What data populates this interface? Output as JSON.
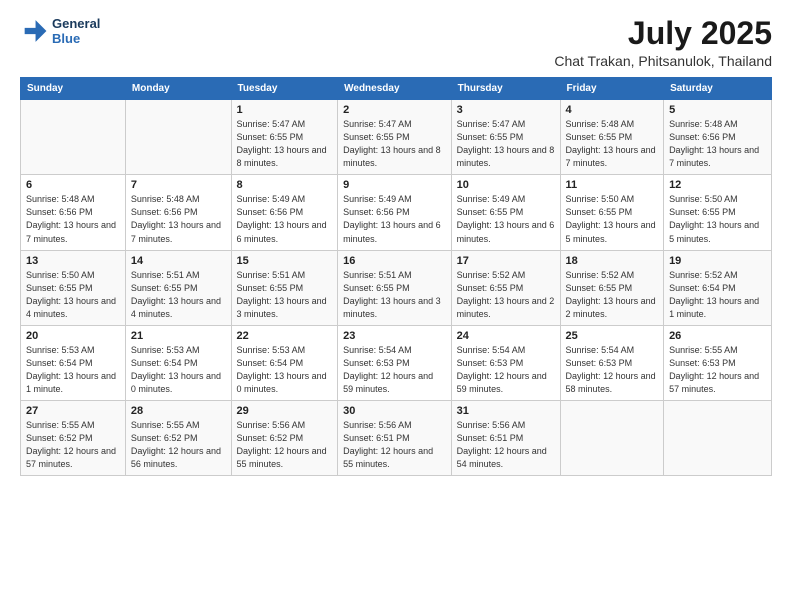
{
  "header": {
    "logo_line1": "General",
    "logo_line2": "Blue",
    "title": "July 2025",
    "subtitle": "Chat Trakan, Phitsanulok, Thailand"
  },
  "days_of_week": [
    "Sunday",
    "Monday",
    "Tuesday",
    "Wednesday",
    "Thursday",
    "Friday",
    "Saturday"
  ],
  "weeks": [
    [
      {
        "day": "",
        "info": ""
      },
      {
        "day": "",
        "info": ""
      },
      {
        "day": "1",
        "info": "Sunrise: 5:47 AM\nSunset: 6:55 PM\nDaylight: 13 hours and 8 minutes."
      },
      {
        "day": "2",
        "info": "Sunrise: 5:47 AM\nSunset: 6:55 PM\nDaylight: 13 hours and 8 minutes."
      },
      {
        "day": "3",
        "info": "Sunrise: 5:47 AM\nSunset: 6:55 PM\nDaylight: 13 hours and 8 minutes."
      },
      {
        "day": "4",
        "info": "Sunrise: 5:48 AM\nSunset: 6:55 PM\nDaylight: 13 hours and 7 minutes."
      },
      {
        "day": "5",
        "info": "Sunrise: 5:48 AM\nSunset: 6:56 PM\nDaylight: 13 hours and 7 minutes."
      }
    ],
    [
      {
        "day": "6",
        "info": "Sunrise: 5:48 AM\nSunset: 6:56 PM\nDaylight: 13 hours and 7 minutes."
      },
      {
        "day": "7",
        "info": "Sunrise: 5:48 AM\nSunset: 6:56 PM\nDaylight: 13 hours and 7 minutes."
      },
      {
        "day": "8",
        "info": "Sunrise: 5:49 AM\nSunset: 6:56 PM\nDaylight: 13 hours and 6 minutes."
      },
      {
        "day": "9",
        "info": "Sunrise: 5:49 AM\nSunset: 6:56 PM\nDaylight: 13 hours and 6 minutes."
      },
      {
        "day": "10",
        "info": "Sunrise: 5:49 AM\nSunset: 6:55 PM\nDaylight: 13 hours and 6 minutes."
      },
      {
        "day": "11",
        "info": "Sunrise: 5:50 AM\nSunset: 6:55 PM\nDaylight: 13 hours and 5 minutes."
      },
      {
        "day": "12",
        "info": "Sunrise: 5:50 AM\nSunset: 6:55 PM\nDaylight: 13 hours and 5 minutes."
      }
    ],
    [
      {
        "day": "13",
        "info": "Sunrise: 5:50 AM\nSunset: 6:55 PM\nDaylight: 13 hours and 4 minutes."
      },
      {
        "day": "14",
        "info": "Sunrise: 5:51 AM\nSunset: 6:55 PM\nDaylight: 13 hours and 4 minutes."
      },
      {
        "day": "15",
        "info": "Sunrise: 5:51 AM\nSunset: 6:55 PM\nDaylight: 13 hours and 3 minutes."
      },
      {
        "day": "16",
        "info": "Sunrise: 5:51 AM\nSunset: 6:55 PM\nDaylight: 13 hours and 3 minutes."
      },
      {
        "day": "17",
        "info": "Sunrise: 5:52 AM\nSunset: 6:55 PM\nDaylight: 13 hours and 2 minutes."
      },
      {
        "day": "18",
        "info": "Sunrise: 5:52 AM\nSunset: 6:55 PM\nDaylight: 13 hours and 2 minutes."
      },
      {
        "day": "19",
        "info": "Sunrise: 5:52 AM\nSunset: 6:54 PM\nDaylight: 13 hours and 1 minute."
      }
    ],
    [
      {
        "day": "20",
        "info": "Sunrise: 5:53 AM\nSunset: 6:54 PM\nDaylight: 13 hours and 1 minute."
      },
      {
        "day": "21",
        "info": "Sunrise: 5:53 AM\nSunset: 6:54 PM\nDaylight: 13 hours and 0 minutes."
      },
      {
        "day": "22",
        "info": "Sunrise: 5:53 AM\nSunset: 6:54 PM\nDaylight: 13 hours and 0 minutes."
      },
      {
        "day": "23",
        "info": "Sunrise: 5:54 AM\nSunset: 6:53 PM\nDaylight: 12 hours and 59 minutes."
      },
      {
        "day": "24",
        "info": "Sunrise: 5:54 AM\nSunset: 6:53 PM\nDaylight: 12 hours and 59 minutes."
      },
      {
        "day": "25",
        "info": "Sunrise: 5:54 AM\nSunset: 6:53 PM\nDaylight: 12 hours and 58 minutes."
      },
      {
        "day": "26",
        "info": "Sunrise: 5:55 AM\nSunset: 6:53 PM\nDaylight: 12 hours and 57 minutes."
      }
    ],
    [
      {
        "day": "27",
        "info": "Sunrise: 5:55 AM\nSunset: 6:52 PM\nDaylight: 12 hours and 57 minutes."
      },
      {
        "day": "28",
        "info": "Sunrise: 5:55 AM\nSunset: 6:52 PM\nDaylight: 12 hours and 56 minutes."
      },
      {
        "day": "29",
        "info": "Sunrise: 5:56 AM\nSunset: 6:52 PM\nDaylight: 12 hours and 55 minutes."
      },
      {
        "day": "30",
        "info": "Sunrise: 5:56 AM\nSunset: 6:51 PM\nDaylight: 12 hours and 55 minutes."
      },
      {
        "day": "31",
        "info": "Sunrise: 5:56 AM\nSunset: 6:51 PM\nDaylight: 12 hours and 54 minutes."
      },
      {
        "day": "",
        "info": ""
      },
      {
        "day": "",
        "info": ""
      }
    ]
  ]
}
